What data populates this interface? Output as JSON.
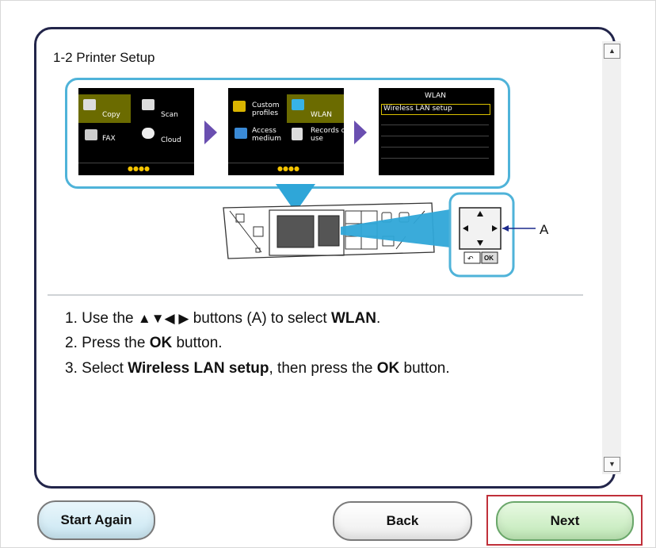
{
  "page": {
    "title": "1-2 Printer Setup"
  },
  "screens": {
    "home1": {
      "copy": "Copy",
      "scan": "Scan",
      "fax": "FAX",
      "cloud": "Cloud"
    },
    "home2": {
      "custom": "Custom\nprofiles",
      "wlan": "WLAN",
      "access": "Access\nmedium",
      "records": "Records of\nuse"
    },
    "wlan": {
      "header": "WLAN",
      "item": "Wireless LAN setup"
    }
  },
  "panel": {
    "callout_label": "A",
    "ok_key": "OK"
  },
  "instructions": [
    {
      "n": "1.",
      "pre": "Use the",
      "arrows": "▲▼◀ ▶",
      "mid": "buttons (A) to select",
      "bold": "WLAN",
      "post": "."
    },
    {
      "n": "2.",
      "pre": "Press the",
      "bold": "OK",
      "post": "button."
    },
    {
      "n": "3.",
      "pre": "Select",
      "bold": "Wireless LAN setup",
      "mid": ", then press the",
      "bold2": "OK",
      "post": "button."
    }
  ],
  "buttons": {
    "start_again": "Start Again",
    "back": "Back",
    "next": "Next"
  },
  "colors": {
    "panel_border": "#22254a",
    "accent_blue": "#4fb3d9",
    "arrow_purple": "#6a4fb0",
    "next_highlight": "#c0303a"
  }
}
